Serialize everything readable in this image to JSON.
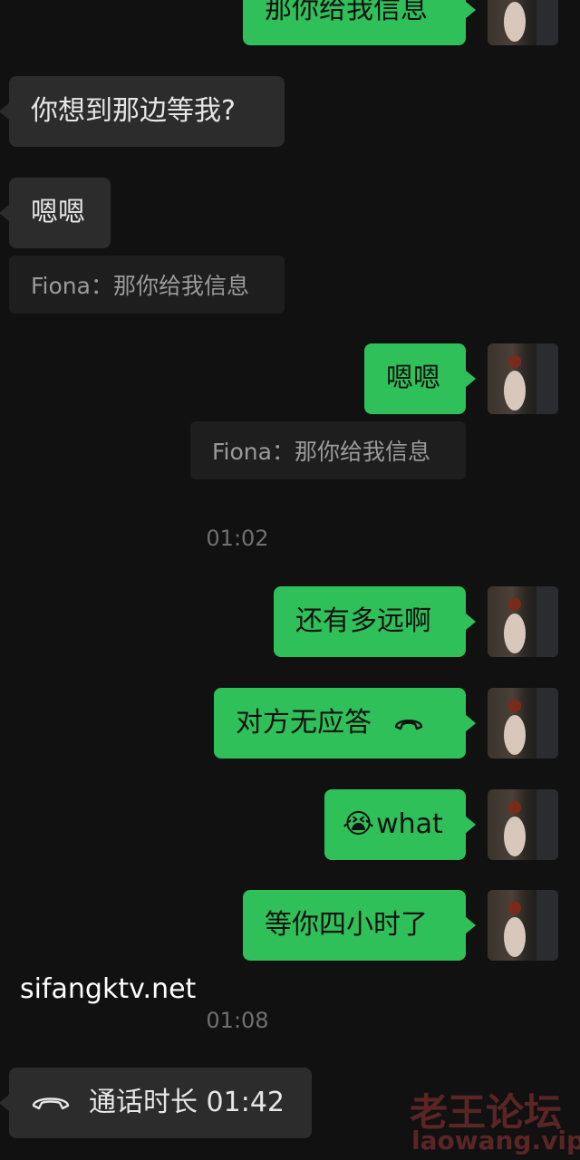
{
  "messages": {
    "m0_text": "那你给我信息",
    "m1_text": "你想到那边等我?",
    "m2_text": "嗯嗯",
    "q1_text": "Fiona：那你给我信息",
    "m3_text": "嗯嗯",
    "q2_text": "Fiona：那你给我信息",
    "time1": "01:02",
    "m4_text": "还有多远啊",
    "m5_text": "对方无应答",
    "m6_emoji": "😭",
    "m6_text": "what",
    "m7_text": "等你四小时了",
    "time2": "01:08",
    "call_text": "通话时长 01:42"
  },
  "watermarks": {
    "site": "sifangktv.net",
    "brand_cn": "老王论坛",
    "brand_url": "laowang.vip"
  },
  "colors": {
    "background": "#111111",
    "outgoing_bubble": "#2fc05a",
    "incoming_bubble": "#2c2c2c",
    "quote_bg": "#1e1e1e"
  }
}
